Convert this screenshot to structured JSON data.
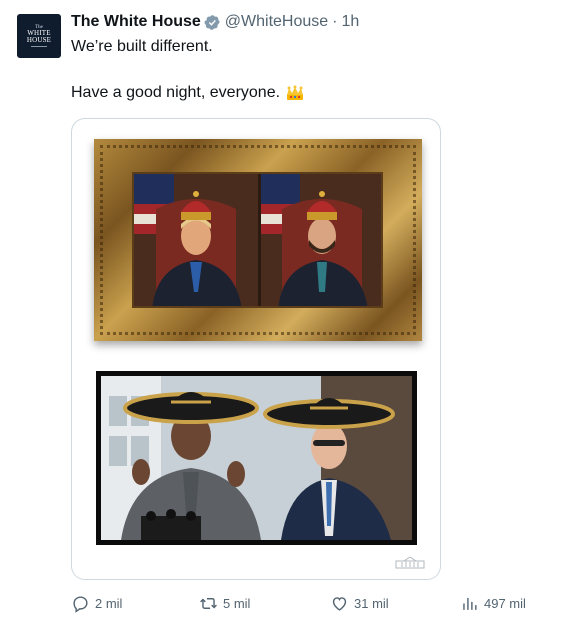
{
  "account": {
    "display_name": "The White House",
    "handle": "@WhiteHouse",
    "separator": "·",
    "time": "1h",
    "avatar_text_top": "The",
    "avatar_text_line1": "WHITE",
    "avatar_text_line2": "HOUSE",
    "verified_icon": "verified-badge-icon"
  },
  "tweet": {
    "line1": "We’re built different.",
    "line2": "Have a good night, everyone.",
    "emoji": "crown-icon"
  },
  "media": {
    "top_image": "gold-framed-double-portrait-with-crowns",
    "bottom_image": "two-men-in-sombreros-photo",
    "watermark_icon": "white-house-watermark-icon"
  },
  "actions": {
    "replies": "2 mil",
    "reposts": "5 mil",
    "likes": "31 mil",
    "views": "497 mil"
  },
  "colors": {
    "text": "#0f1419",
    "secondary": "#536471",
    "verified": "#829aab",
    "border": "#cfd9de"
  }
}
